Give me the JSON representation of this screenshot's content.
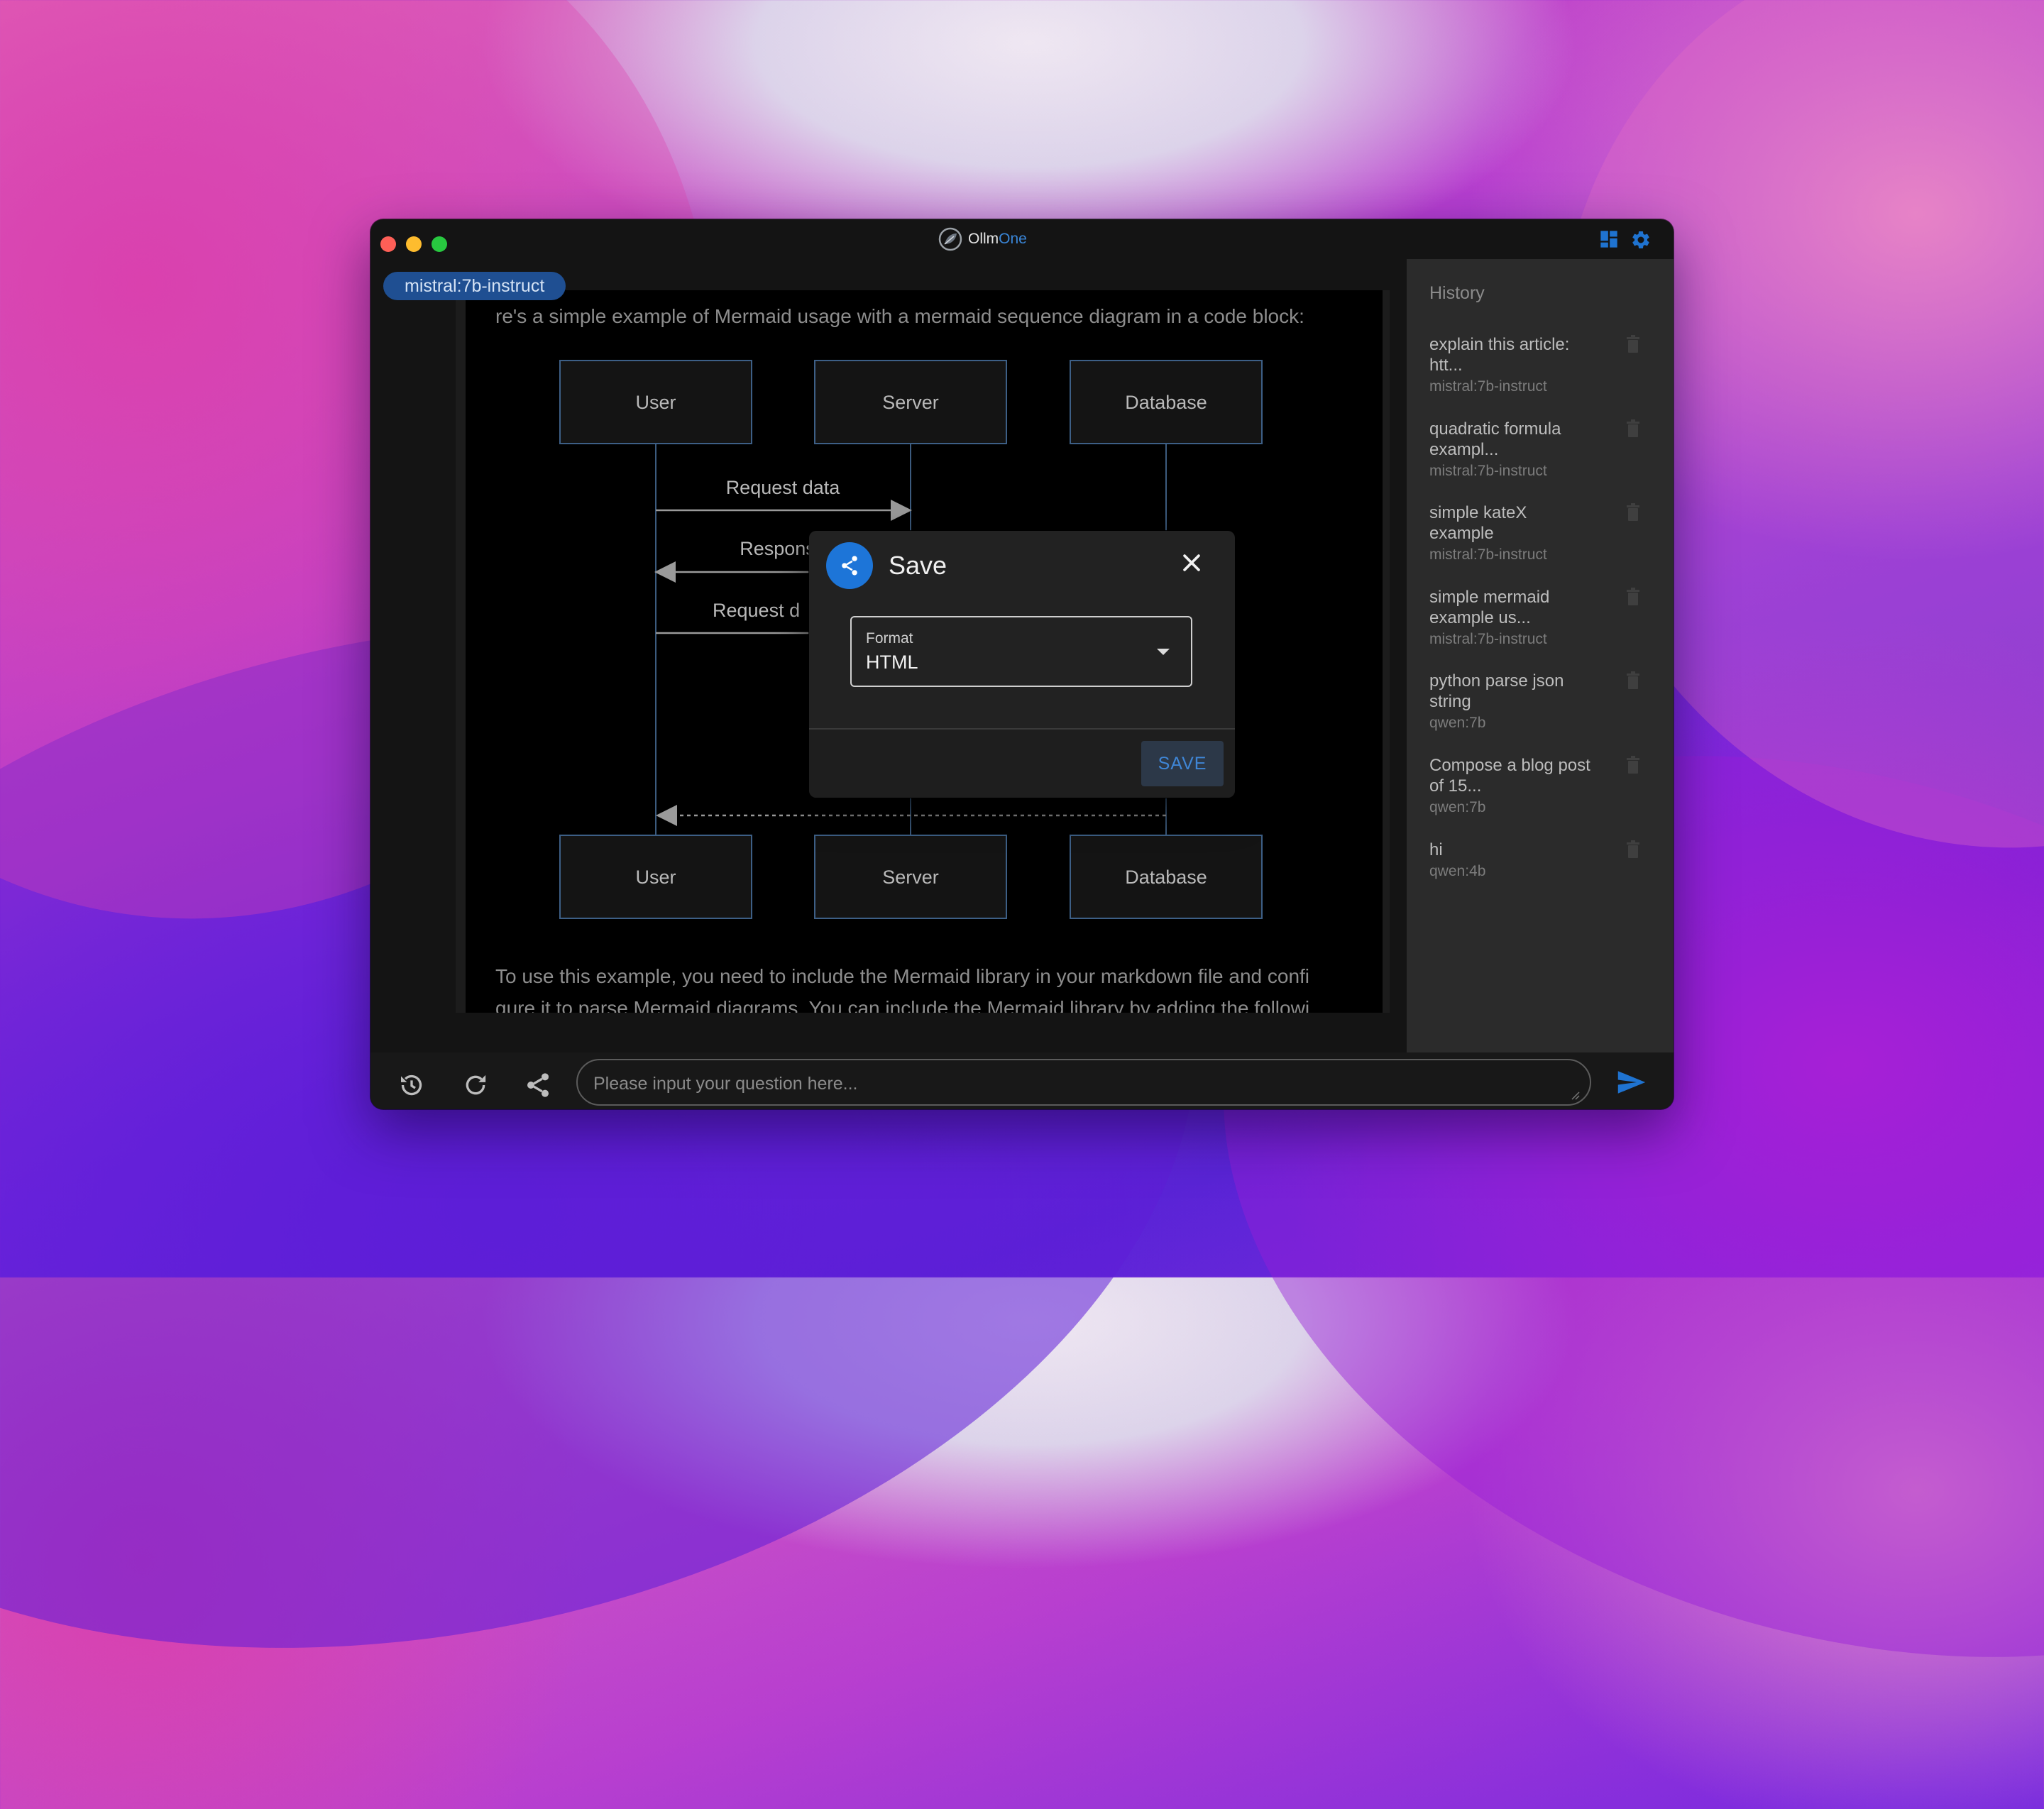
{
  "app": {
    "brand_prefix": "Ollm",
    "brand_suffix": "One"
  },
  "chat": {
    "model_chip": "mistral:7b-instruct",
    "intro_text": "re's a simple example of Mermaid usage with a mermaid sequence diagram in a code block:",
    "outro_line1": "To use this example, you need to include the Mermaid library in your markdown file and confi",
    "outro_line2": "gure it to parse Mermaid diagrams. You can include the Mermaid library by adding the followi"
  },
  "diagram": {
    "participants": [
      "User",
      "Server",
      "Database"
    ],
    "messages": [
      "Request data",
      "Response",
      "Request d"
    ]
  },
  "history": {
    "title": "History",
    "items": [
      {
        "title": "explain this article: htt...",
        "model": "mistral:7b-instruct"
      },
      {
        "title": "quadratic formula exampl...",
        "model": "mistral:7b-instruct"
      },
      {
        "title": "simple kateX example",
        "model": "mistral:7b-instruct"
      },
      {
        "title": "simple mermaid example us...",
        "model": "mistral:7b-instruct"
      },
      {
        "title": "python parse json string",
        "model": "qwen:7b"
      },
      {
        "title": "Compose a blog post of 15...",
        "model": "qwen:7b"
      },
      {
        "title": "hi",
        "model": "qwen:4b"
      }
    ]
  },
  "input": {
    "placeholder": "Please input your question here..."
  },
  "dialog": {
    "title": "Save",
    "format_label": "Format",
    "format_value": "HTML",
    "save_label": "SAVE"
  },
  "colors": {
    "accent": "#1d75d8",
    "model_chip": "#1f4f92",
    "sidebar": "#2b2b2b"
  }
}
